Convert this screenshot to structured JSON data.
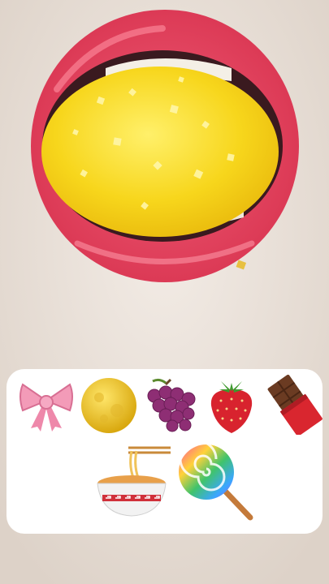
{
  "scene": {
    "subject": "mouth-biting-yellow-sugar-candy",
    "colors": {
      "skin": "#ece4dc",
      "lips": "#e2435f",
      "lip_highlight": "#ff8fa0",
      "candy": "#f6d31a",
      "candy_highlight": "#fff27a",
      "teeth": "#f4efe6",
      "panel": "#ffffff"
    }
  },
  "emoji_panel": {
    "row1": [
      "bow-icon",
      "moon-icon",
      "grapes-icon",
      "strawberry-icon",
      "chocolate-bar-icon"
    ],
    "row2": [
      "noodle-bowl-icon",
      "lollipop-icon"
    ]
  }
}
